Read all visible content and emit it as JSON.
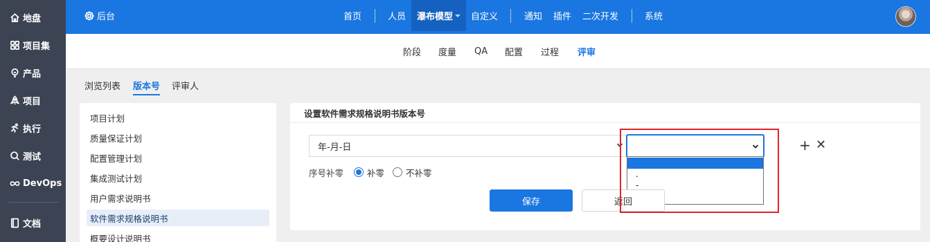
{
  "sidebar": {
    "items": [
      {
        "label": "地盘",
        "icon": "home-icon"
      },
      {
        "label": "项目集",
        "icon": "grid-icon"
      },
      {
        "label": "产品",
        "icon": "bulb-icon"
      },
      {
        "label": "项目",
        "icon": "rocket-icon"
      },
      {
        "label": "执行",
        "icon": "run-icon"
      },
      {
        "label": "测试",
        "icon": "search-icon"
      },
      {
        "label": "DevOps",
        "icon": "infinity-icon"
      },
      {
        "label": "文档",
        "icon": "book-icon"
      }
    ]
  },
  "header": {
    "backend_label": "后台",
    "nav": [
      "首页",
      "人员",
      "瀑布模型",
      "自定义",
      "通知",
      "插件",
      "二次开发",
      "系统"
    ],
    "active_nav": "瀑布模型"
  },
  "subnav": {
    "items": [
      "阶段",
      "度量",
      "QA",
      "配置",
      "过程",
      "评审"
    ],
    "active": "评审"
  },
  "tabs": {
    "items": [
      "浏览列表",
      "版本号",
      "评审人"
    ],
    "active": "版本号"
  },
  "doclist": {
    "items": [
      "项目计划",
      "质量保证计划",
      "配置管理计划",
      "集成测试计划",
      "用户需求说明书",
      "软件需求规格说明书",
      "概要设计说明书"
    ],
    "active": "软件需求规格说明书"
  },
  "panel": {
    "title": "设置软件需求规格说明书版本号",
    "format_value": "年-月-日",
    "separator_value": "",
    "separator_options": [
      "",
      ".",
      "-",
      "_"
    ],
    "pad_label": "序号补零",
    "pad_options": [
      "补零",
      "不补零"
    ],
    "pad_selected": "补零",
    "save_label": "保存",
    "back_label": "返回",
    "add_symbol": "+",
    "remove_symbol": "✕"
  },
  "colors": {
    "topbar": "#1a76e0",
    "sidebar": "#3c4353",
    "accent": "#1a76e0",
    "highlight_box": "#e0212b"
  }
}
